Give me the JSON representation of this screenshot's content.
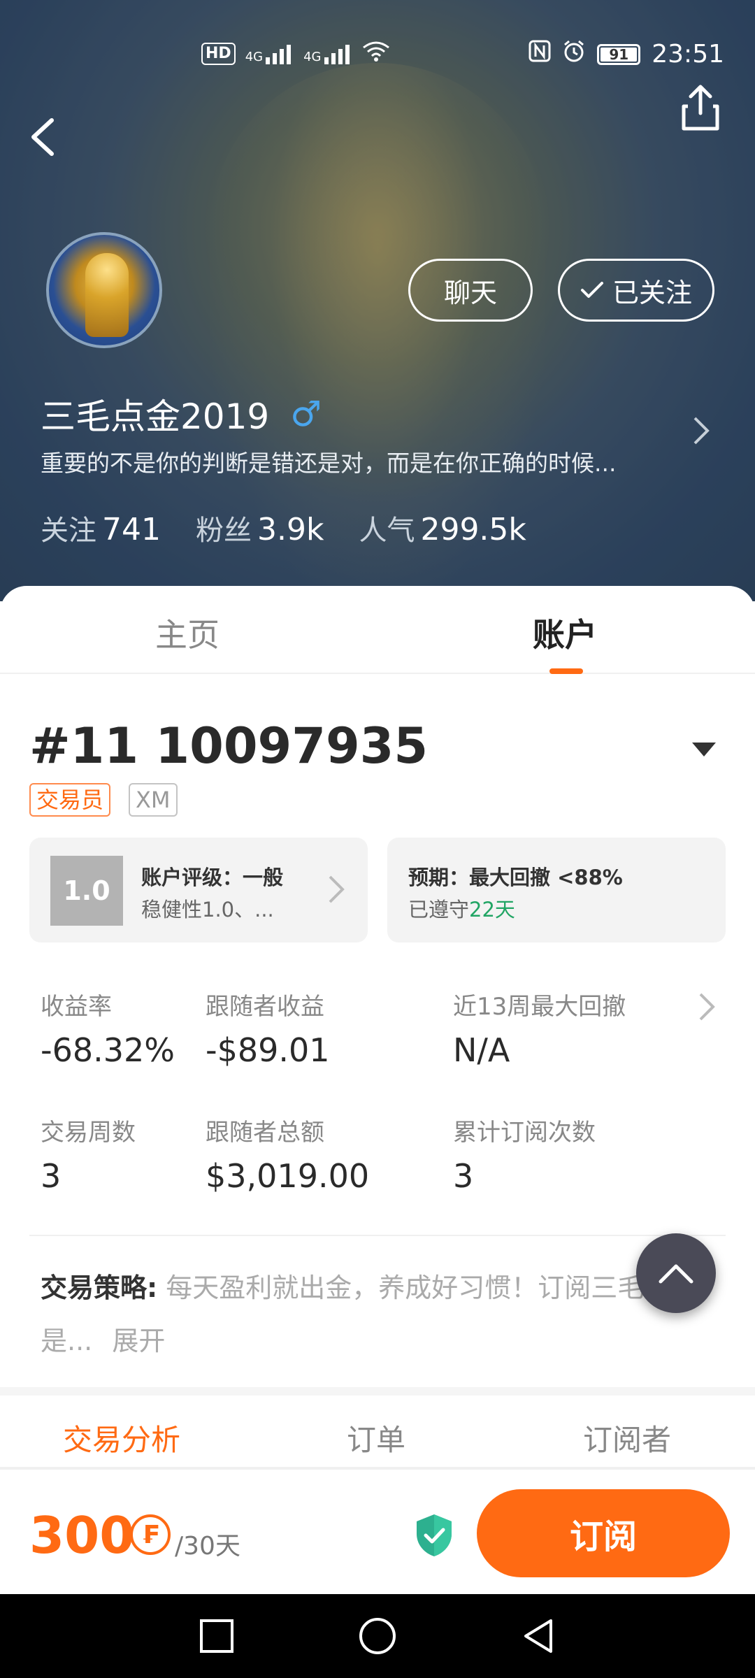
{
  "status_bar": {
    "left_icons": [
      "hd-icon",
      "4g-signal-icon",
      "4g-signal-icon",
      "wifi-icon"
    ],
    "right_icons": [
      "nfc-icon",
      "alarm-icon"
    ],
    "battery": "91",
    "time": "23:51",
    "hd_label": "HD",
    "net_label_1": "4G",
    "net_label_2": "4G"
  },
  "header": {
    "chat_label": "聊天",
    "follow_label": "已关注",
    "name": "三毛点金2019",
    "gender_symbol": "♂",
    "bio": "重要的不是你的判断是错还是对，而是在你正确的时候...",
    "stats": [
      {
        "label": "关注",
        "value": "741"
      },
      {
        "label": "粉丝",
        "value": "3.9k"
      },
      {
        "label": "人气",
        "value": "299.5k"
      }
    ]
  },
  "tabs": [
    {
      "label": "主页"
    },
    {
      "label": "账户"
    }
  ],
  "account": {
    "number": "#11 10097935",
    "tags": [
      "交易员",
      "XM"
    ],
    "rating_score": "1.0",
    "rating_title": "账户评级：一般",
    "rating_sub": "稳健性1.0、...",
    "expect_title": "预期：最大回撤 <88%",
    "expect_sub_prefix": "已遵守",
    "expect_sub_days": "22天"
  },
  "metrics": [
    {
      "label": "收益率",
      "value": "-68.32%"
    },
    {
      "label": "跟随者收益",
      "value": "-$89.01"
    },
    {
      "label": "近13周最大回撤",
      "value": "N/A"
    },
    {
      "label": "交易周数",
      "value": "3"
    },
    {
      "label": "跟随者总额",
      "value": "$3,019.00"
    },
    {
      "label": "累计订阅次数",
      "value": "3"
    }
  ],
  "strategy": {
    "label": "交易策略:",
    "text": "每天盈利就出金，养成好习惯！订阅三毛就是...",
    "more": "展开"
  },
  "bottom_tabs": [
    {
      "label": "交易分析"
    },
    {
      "label": "订单"
    },
    {
      "label": "订阅者"
    }
  ],
  "subscribe": {
    "price": "300",
    "currency_symbol": "₣",
    "period": "/30天",
    "button_label": "订阅"
  },
  "colors": {
    "accent": "#ff6a13",
    "green": "#21a564",
    "gender_blue": "#4aa6ee"
  }
}
